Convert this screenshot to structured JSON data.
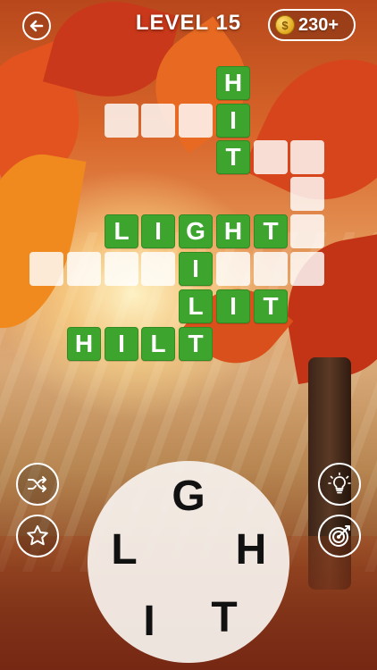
{
  "header": {
    "level_text": "LEVEL 15",
    "coins": "230+"
  },
  "grid": {
    "row_hit": [
      "H",
      "I",
      "T"
    ],
    "row_light": [
      "L",
      "I",
      "G",
      "H",
      "T"
    ],
    "row_lit": [
      "L",
      "I",
      "T"
    ],
    "row_hilt": [
      "H",
      "I",
      "L",
      "T"
    ],
    "i_cell": "I"
  },
  "wheel": {
    "letters": [
      "G",
      "L",
      "H",
      "I",
      "T"
    ]
  },
  "buttons": {
    "shuffle_icon": "shuffle-icon",
    "star_icon": "star-icon",
    "hint_icon": "lightbulb-icon",
    "target_icon": "target-icon"
  },
  "colors": {
    "filled_tile": "#3da52d",
    "empty_tile": "#ffffff"
  }
}
